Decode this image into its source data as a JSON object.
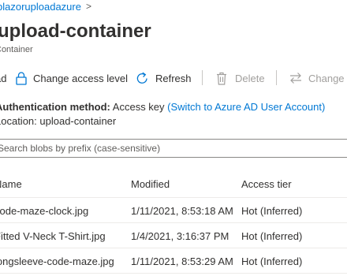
{
  "breadcrumb": {
    "storage_account": "blazoruploadazure",
    "separator": ">"
  },
  "page": {
    "title": "upload-container",
    "subtitle": "Container"
  },
  "toolbar": {
    "upload_partial": "ad",
    "change_access_level": "Change access level",
    "refresh": "Refresh",
    "delete": "Delete",
    "change_tier": "Change tier"
  },
  "auth": {
    "label": "Authentication method:",
    "value": "Access key",
    "switch_link": "(Switch to Azure AD User Account)"
  },
  "location": {
    "label": "Location:",
    "value": "upload-container"
  },
  "search": {
    "placeholder": "Search blobs by prefix (case-sensitive)"
  },
  "table": {
    "columns": {
      "name": "Name",
      "modified": "Modified",
      "access_tier": "Access tier"
    },
    "rows": [
      {
        "name": "code-maze-clock.jpg",
        "modified": "1/11/2021, 8:53:18 AM",
        "tier": "Hot (Inferred)"
      },
      {
        "name": "Fitted V-Neck T-Shirt.jpg",
        "modified": "1/4/2021, 3:16:37 PM",
        "tier": "Hot (Inferred)"
      },
      {
        "name": "longsleeve-code-maze.jpg",
        "modified": "1/11/2021, 8:53:29 AM",
        "tier": "Hot (Inferred)"
      }
    ]
  },
  "icons": {
    "lock": "lock-icon",
    "refresh": "refresh-icon",
    "delete": "trash-icon",
    "change_tier": "swap-arrows-icon"
  },
  "colors": {
    "link": "#0078d4",
    "text": "#323130",
    "disabled": "#a19f9d",
    "border": "#8a8886"
  }
}
